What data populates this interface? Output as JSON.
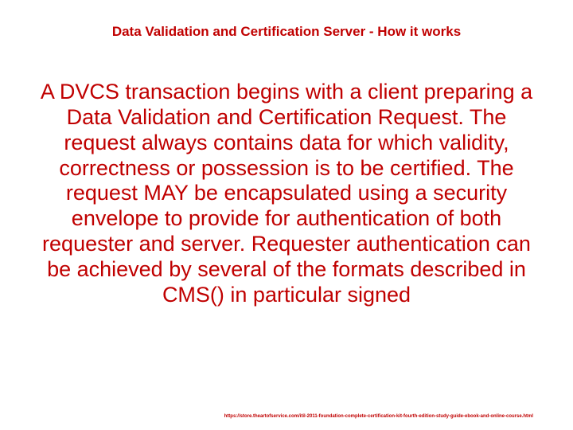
{
  "title": "Data Validation and Certification Server - How it works",
  "body": "A DVCS transaction begins with a client preparing a Data Validation and Certification Request.  The request always contains data for which validity, correctness or possession is to be certified.  The request MAY be encapsulated using a security envelope to provide for authentication of both requester and server.  Requester authentication can be achieved by several of the formats described in CMS()  in particular  signed",
  "footer": "https://store.theartofservice.com/itil-2011-foundation-complete-certification-kit-fourth-edition-study-guide-ebook-and-online-course.html"
}
